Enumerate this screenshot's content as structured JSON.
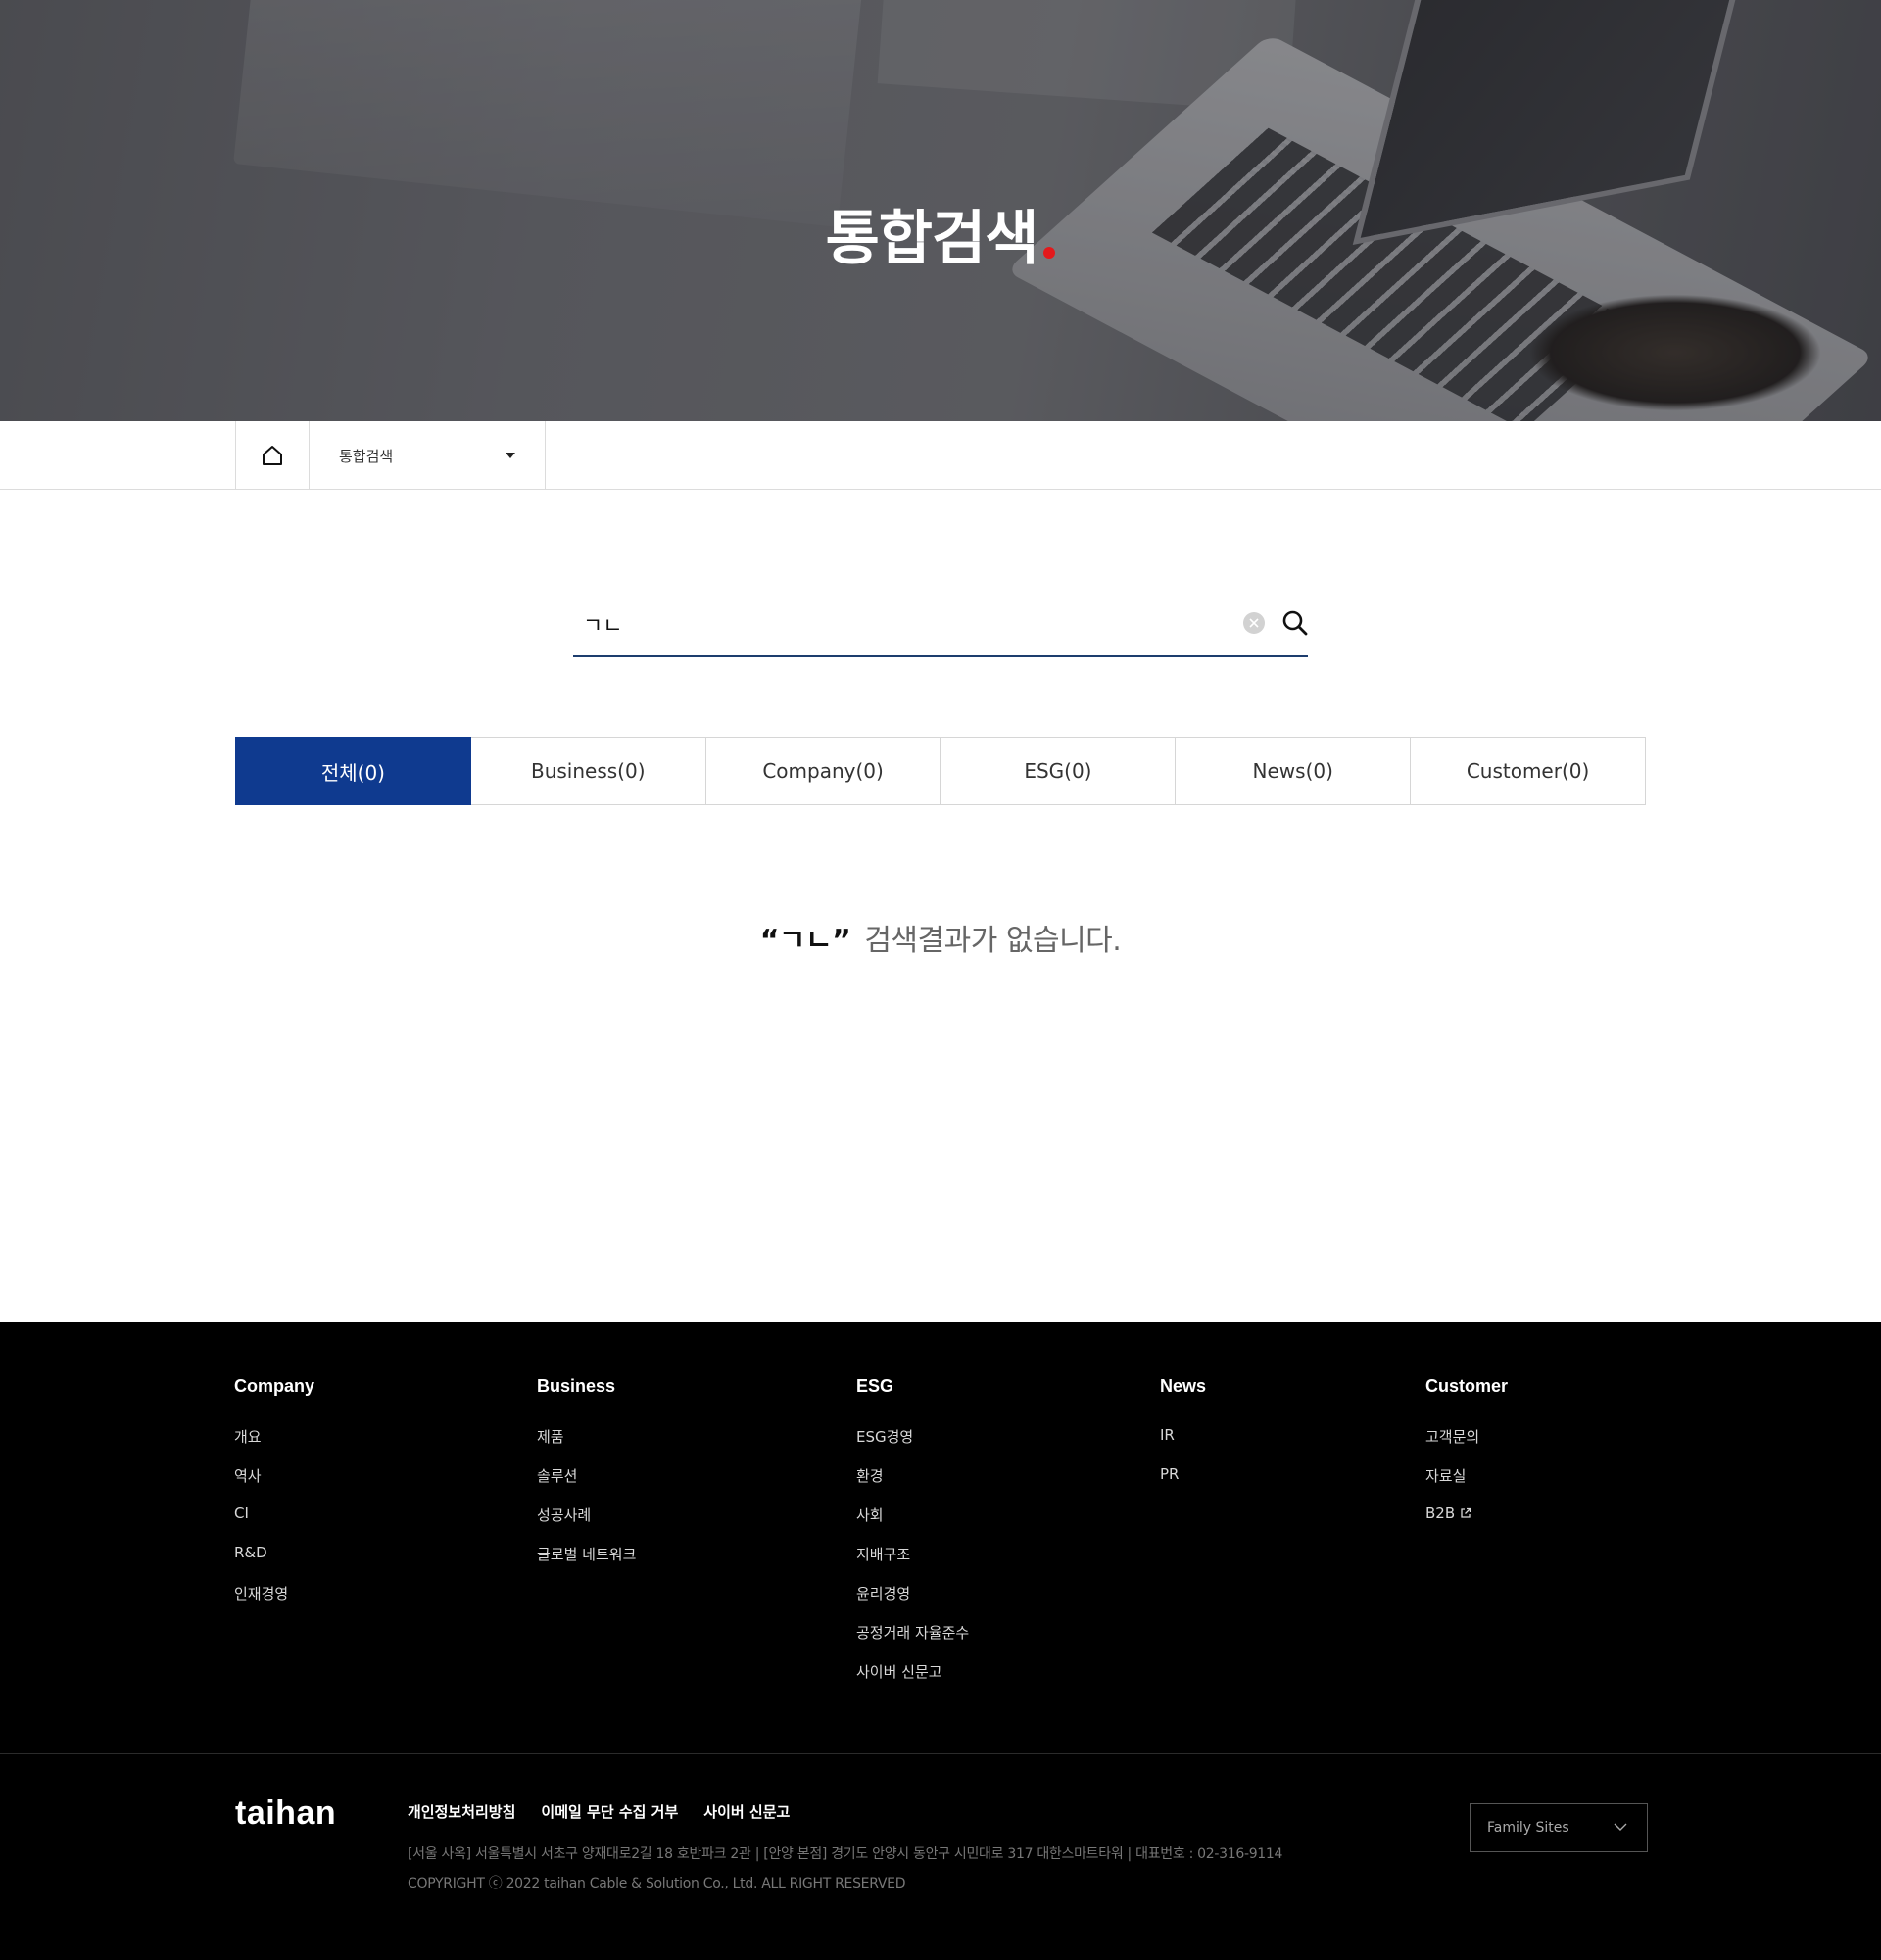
{
  "hero": {
    "title": "통합검색"
  },
  "breadcrumb": {
    "current": "통합검색"
  },
  "search": {
    "value": "ㄱㄴ"
  },
  "tabs": [
    {
      "label": "전체(0)"
    },
    {
      "label": "Business(0)"
    },
    {
      "label": "Company(0)"
    },
    {
      "label": "ESG(0)"
    },
    {
      "label": "News(0)"
    },
    {
      "label": "Customer(0)"
    }
  ],
  "no_result": {
    "query": "“ㄱㄴ”",
    "message": "검색결과가 없습니다."
  },
  "footer": {
    "columns": [
      {
        "title": "Company",
        "items": [
          "개요",
          "역사",
          "CI",
          "R&D",
          "인재경영"
        ]
      },
      {
        "title": "Business",
        "items": [
          "제품",
          "솔루션",
          "성공사례",
          "글로벌 네트워크"
        ]
      },
      {
        "title": "ESG",
        "items": [
          "ESG경영",
          "환경",
          "사회",
          "지배구조",
          "윤리경영",
          "공정거래 자율준수",
          "사이버 신문고"
        ]
      },
      {
        "title": "News",
        "items": [
          "IR",
          "PR"
        ]
      },
      {
        "title": "Customer",
        "items": [
          "고객문의",
          "자료실",
          "B2B"
        ]
      }
    ],
    "logo": "taihan",
    "links": [
      "개인정보처리방침",
      "이메일 무단 수집 거부",
      "사이버 신문고"
    ],
    "address": "[서울 사옥] 서울특별시 서초구 양재대로2길 18 호반파크 2관   |   [안양 본점] 경기도 안양시 동안구 시민대로 317 대한스마트타워   |   대표번호 : 02-316-9114",
    "copyright": "COPYRIGHT ⓒ 2022 taihan Cable & Solution Co., Ltd. ALL RIGHT RESERVED",
    "family_sites": "Family Sites"
  },
  "colors": {
    "accent": "#0f3a8f",
    "dot": "#e3191c",
    "footer_bg": "#000000"
  }
}
